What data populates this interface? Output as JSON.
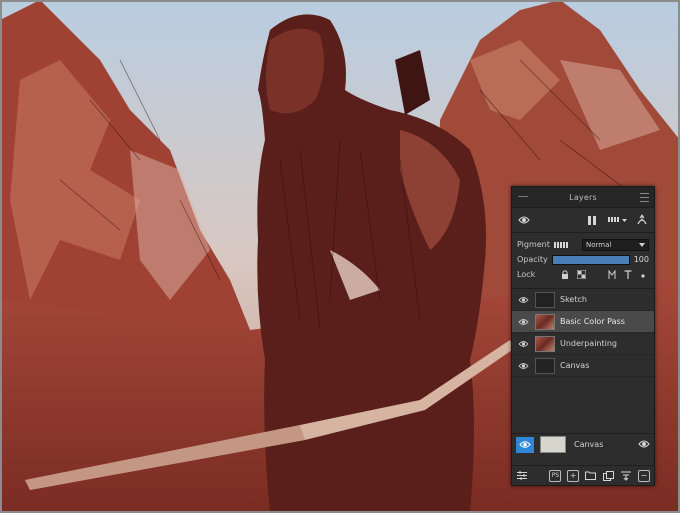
{
  "panel": {
    "title": "Layers",
    "pigment_label": "Pigment",
    "blend_mode": "Normal",
    "opacity_label": "Opacity",
    "opacity_value": "100",
    "opacity_fraction": 1.0,
    "lock_label": "Lock"
  },
  "layers": [
    {
      "name": "Sketch",
      "active": false,
      "thumb": "empty"
    },
    {
      "name": "Basic Color Pass",
      "active": true,
      "thumb": "art"
    },
    {
      "name": "Underpainting",
      "active": false,
      "thumb": "art"
    },
    {
      "name": "Canvas",
      "active": false,
      "thumb": "empty"
    }
  ],
  "canvas_layer": {
    "label": "Canvas",
    "swatch_color": "#d6d6cc"
  },
  "bottom_toolbar": {
    "ps_label": "PS"
  },
  "colors": {
    "accent": "#2f86d6",
    "panel_bg": "#2d2d2d"
  }
}
